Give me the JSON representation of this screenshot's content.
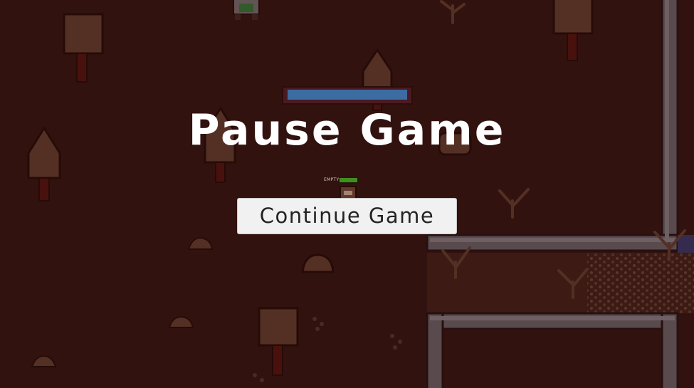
{
  "pause_menu": {
    "title": "Pause Game",
    "continue_label": "Continue Game"
  },
  "hud": {
    "boss_health_fraction": 1.0,
    "player_status": "EMPTY",
    "player_health_fraction": 1.0
  },
  "colors": {
    "ground": "#3a1712",
    "overlay_tint": "#1e0806",
    "health_blue": "#3d6ca3",
    "health_green": "#3f8f1f",
    "wall": "#8a7f82"
  }
}
